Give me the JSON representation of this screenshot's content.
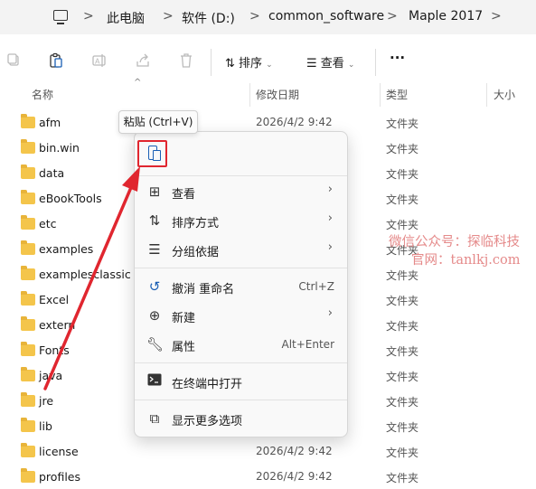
{
  "address_bar": {
    "icon": "computer-icon",
    "crumbs": [
      "此电脑",
      "软件 (D:)",
      "common_software",
      "Maple 2017"
    ],
    "separator": ">"
  },
  "toolbar": {
    "icons": [
      "copy-icon",
      "paste-icon",
      "rename-icon",
      "share-icon",
      "delete-icon"
    ],
    "sort_label": "排序",
    "view_label": "查看",
    "more_label": "···"
  },
  "columns": {
    "name": "名称",
    "date": "修改日期",
    "type": "类型",
    "size": "大小"
  },
  "files": [
    {
      "name": "afm",
      "date": "2026/4/2 9:42",
      "type": "文件夹"
    },
    {
      "name": "bin.win",
      "date": "",
      "type": "文件夹"
    },
    {
      "name": "data",
      "date": "",
      "type": "文件夹"
    },
    {
      "name": "eBookTools",
      "date": "",
      "type": "文件夹"
    },
    {
      "name": "etc",
      "date": "",
      "type": "文件夹"
    },
    {
      "name": "examples",
      "date": "",
      "type": "文件夹"
    },
    {
      "name": "examplesclassic",
      "date": "",
      "type": "文件夹"
    },
    {
      "name": "Excel",
      "date": "",
      "type": "文件夹"
    },
    {
      "name": "extern",
      "date": "",
      "type": "文件夹"
    },
    {
      "name": "Fonts",
      "date": "",
      "type": "文件夹"
    },
    {
      "name": "java",
      "date": "",
      "type": "文件夹"
    },
    {
      "name": "jre",
      "date": "",
      "type": "文件夹"
    },
    {
      "name": "lib",
      "date": "",
      "type": "文件夹"
    },
    {
      "name": "license",
      "date": "2026/4/2 9:42",
      "type": "文件夹"
    },
    {
      "name": "profiles",
      "date": "2026/4/2 9:42",
      "type": "文件夹"
    }
  ],
  "tooltip": "粘贴 (Ctrl+V)",
  "context_menu": {
    "items": [
      {
        "label": "查看",
        "icon": "grid-icon",
        "submenu": true,
        "shortcut": ""
      },
      {
        "label": "排序方式",
        "icon": "sort-icon",
        "submenu": true,
        "shortcut": ""
      },
      {
        "label": "分组依据",
        "icon": "group-icon",
        "submenu": true,
        "shortcut": ""
      },
      {
        "label": "撤消 重命名",
        "icon": "undo-icon",
        "submenu": false,
        "shortcut": "Ctrl+Z"
      },
      {
        "label": "新建",
        "icon": "new-icon",
        "submenu": true,
        "shortcut": ""
      },
      {
        "label": "属性",
        "icon": "wrench-icon",
        "submenu": false,
        "shortcut": "Alt+Enter"
      },
      {
        "label": "在终端中打开",
        "icon": "terminal-icon",
        "submenu": false,
        "shortcut": ""
      },
      {
        "label": "显示更多选项",
        "icon": "more-options-icon",
        "submenu": false,
        "shortcut": ""
      }
    ]
  },
  "watermark": {
    "line1": "微信公众号：探临科技",
    "line2": "官网：tanlkj.com"
  },
  "colors": {
    "folder": "#f4c54b",
    "highlight_box": "#e0262f",
    "arrow": "#e0262f",
    "watermark": "#e58a8a"
  }
}
